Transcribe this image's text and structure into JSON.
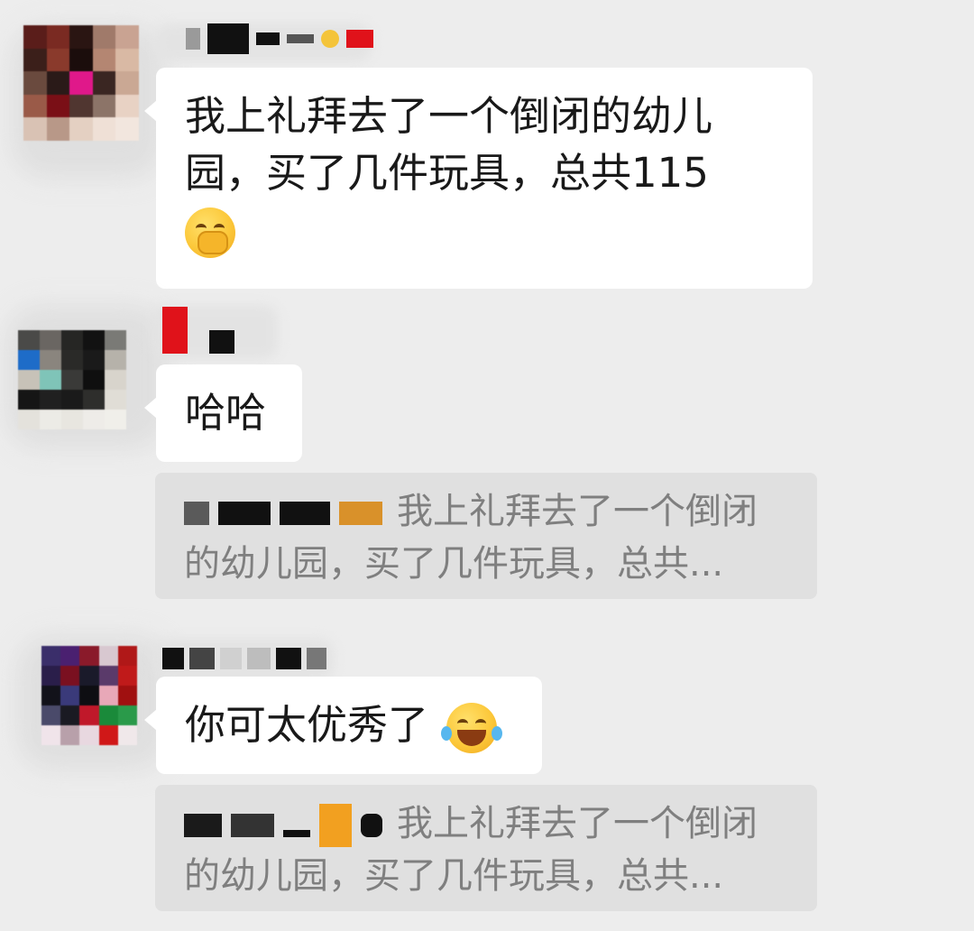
{
  "messages": [
    {
      "text": "我上礼拜去了一个倒闭的幼儿园，买了几件玩具，总共115",
      "emoji": "shy-smile-emoji"
    },
    {
      "text": "哈哈"
    },
    {
      "text": "你可太优秀了",
      "emoji": "tears-of-joy-emoji"
    }
  ],
  "quotes": [
    {
      "text": "我上礼拜去了一个倒闭的幼儿园，买了几件玩具，总共..."
    },
    {
      "text": "我上礼拜去了一个倒闭的幼儿园，买了几件玩具，总共..."
    }
  ],
  "colors": {
    "background": "#ededed",
    "bubble": "#ffffff",
    "quote_card": "#e0e0e0",
    "quote_text": "#7f7f7f"
  }
}
